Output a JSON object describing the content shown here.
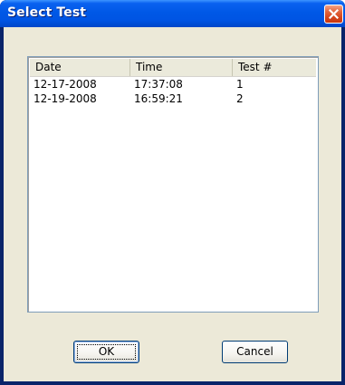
{
  "window": {
    "title": "Select Test"
  },
  "list": {
    "columns": [
      "Date",
      "Time",
      "Test #"
    ],
    "rows": [
      {
        "date": "12-17-2008",
        "time": "17:37:08",
        "test": "1"
      },
      {
        "date": "12-19-2008",
        "time": "16:59:21",
        "test": "2"
      }
    ]
  },
  "buttons": {
    "ok_label": "OK",
    "cancel_label": "Cancel"
  },
  "icons": {
    "close": "close-icon"
  },
  "colors": {
    "titlebar": "#0054e3",
    "close_button": "#d5451c",
    "dialog_face": "#ece9d8",
    "list_border": "#7f9db9"
  }
}
